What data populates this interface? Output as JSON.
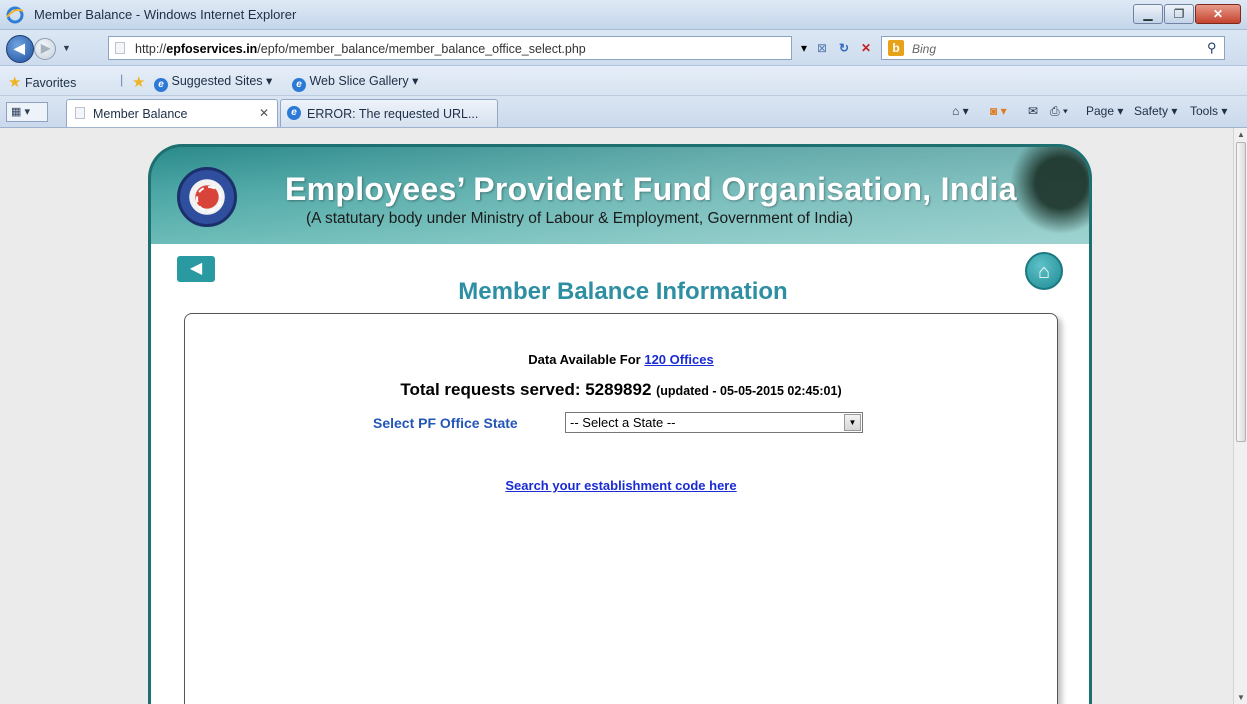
{
  "window": {
    "title": "Member Balance - Windows Internet Explorer",
    "min_glyph": "▁",
    "max_glyph": "❐",
    "close_glyph": "✕"
  },
  "address": {
    "url_prefix": "http://",
    "url_domain": "epfoservices.in",
    "url_path": "/epfo/member_balance/member_balance_office_select.php",
    "search_engine": "Bing"
  },
  "favorites": {
    "label": "Favorites",
    "items": [
      "Suggested Sites ▾",
      "Web Slice Gallery ▾"
    ]
  },
  "tabs": [
    {
      "label": "Member Balance",
      "active": true
    },
    {
      "label": "ERROR: The requested URL...",
      "active": false
    }
  ],
  "command_bar": [
    "Page ▾",
    "Safety ▾",
    "Tools ▾"
  ],
  "site": {
    "org_name": "Employees’ Provident Fund Organisation, India",
    "org_subtitle": "(A statutary body under Ministry of Labour & Employment, Government of India)",
    "page_title": "Member Balance Information",
    "data_available_prefix": "Data Available For ",
    "data_available_link": "120 Offices",
    "total_requests": "Total requests served: 5289892 ",
    "updated": "(updated - 05-05-2015 02:45:01)",
    "state_label": "Select PF Office State",
    "state_select_value": "-- Select a State --",
    "search_link": "Search your establishment code here"
  },
  "colors": {
    "banner": "#2b8a8b",
    "title": "#2e8fa3",
    "link": "#1a2bd4",
    "state_label": "#2456b8"
  }
}
